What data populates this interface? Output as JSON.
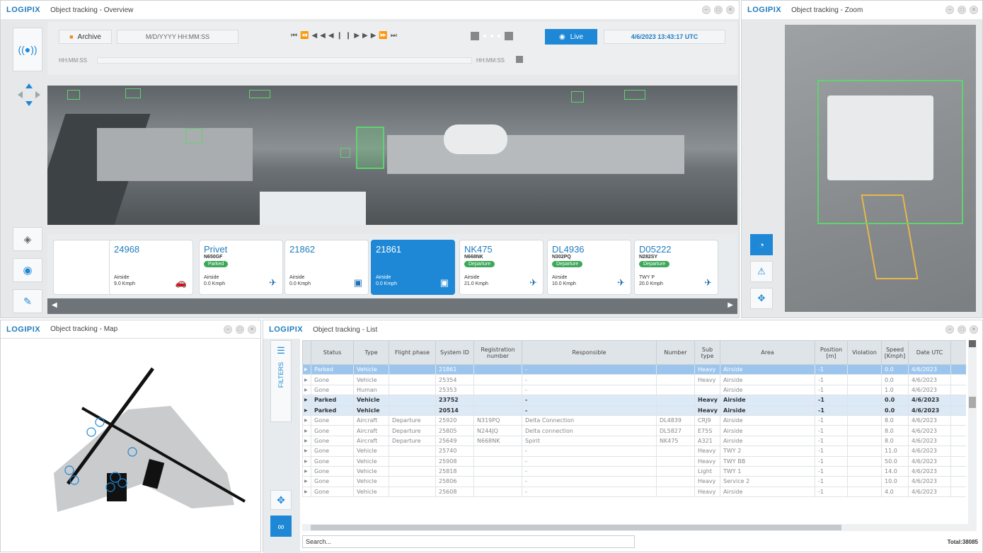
{
  "overview": {
    "logo": "LOGIPIX",
    "title": "Object tracking - Overview",
    "archive_label": "Archive",
    "datetime_placeholder": "M/D/YYYY HH:MM:SS",
    "live_label": "Live",
    "current_time": "4/6/2023 13:43:17 UTC",
    "time_start": "HH:MM:SS",
    "time_end": "HH:MM:SS",
    "cards": [
      {
        "id": "",
        "reg": "",
        "badge": "",
        "area": "",
        "speed": "",
        "icon": "bus"
      },
      {
        "id": "24968",
        "reg": "",
        "badge": "",
        "area": "Airside",
        "speed": "9.0 Kmph",
        "icon": "car"
      },
      {
        "id": "Privet",
        "reg": "N650GF",
        "badge": "Parked",
        "area": "Airside",
        "speed": "0.0 Kmph",
        "icon": "plane"
      },
      {
        "id": "21862",
        "reg": "",
        "badge": "",
        "area": "Airside",
        "speed": "0.0 Kmph",
        "icon": "bus"
      },
      {
        "id": "21861",
        "reg": "",
        "badge": "",
        "area": "Airside",
        "speed": "0.0 Kmph",
        "icon": "bus"
      },
      {
        "id": "NK475",
        "reg": "N668NK",
        "badge": "Departure",
        "area": "Airside",
        "speed": "21.0 Kmph",
        "icon": "plane"
      },
      {
        "id": "DL4936",
        "reg": "N302PQ",
        "badge": "Departure",
        "area": "Airside",
        "speed": "10.0 Kmph",
        "icon": "plane"
      },
      {
        "id": "D05222",
        "reg": "N282SY",
        "badge": "Departure",
        "area": "TWY P",
        "speed": "20.0 Kmph",
        "icon": "plane"
      }
    ]
  },
  "zoom": {
    "logo": "LOGIPIX",
    "title": "Object tracking - Zoom"
  },
  "map": {
    "logo": "LOGIPIX",
    "title": "Object tracking - Map"
  },
  "list": {
    "logo": "LOGIPIX",
    "title": "Object tracking - List",
    "filters_label": "FILTERS",
    "search_placeholder": "Search...",
    "total": "Total:38085",
    "columns": [
      "Status",
      "Type",
      "Flight phase",
      "System ID",
      "Registration number",
      "Responsible",
      "Number",
      "Sub type",
      "Area",
      "Position [m]",
      "Violation",
      "Speed [Kmph]",
      "Date UTC"
    ],
    "rows": [
      [
        "Parked",
        "Vehicle",
        "",
        "21861",
        "",
        "-",
        "",
        "Heavy",
        "Airside",
        "-1",
        "",
        "0.0",
        "4/6/2023"
      ],
      [
        "Gone",
        "Vehicle",
        "",
        "25354",
        "",
        "-",
        "",
        "Heavy",
        "Airside",
        "-1",
        "",
        "0.0",
        "4/6/2023"
      ],
      [
        "Gone",
        "Human",
        "",
        "25353",
        "",
        "-",
        "",
        "",
        "Airside",
        "-1",
        "",
        "1.0",
        "4/6/2023"
      ],
      [
        "Parked",
        "Vehicle",
        "",
        "23752",
        "",
        "-",
        "",
        "Heavy",
        "Airside",
        "-1",
        "",
        "0.0",
        "4/6/2023"
      ],
      [
        "Parked",
        "Vehicle",
        "",
        "20514",
        "",
        "-",
        "",
        "Heavy",
        "Airside",
        "-1",
        "",
        "0.0",
        "4/6/2023"
      ],
      [
        "Gone",
        "Aircraft",
        "Departure",
        "25920",
        "N319PQ",
        "Delta Connection",
        "DL4839",
        "CRJ9",
        "Airside",
        "-1",
        "",
        "8.0",
        "4/6/2023"
      ],
      [
        "Gone",
        "Aircraft",
        "Departure",
        "25805",
        "N244JQ",
        "Delta connection",
        "DL5827",
        "E75S",
        "Airside",
        "-1",
        "",
        "8.0",
        "4/6/2023"
      ],
      [
        "Gone",
        "Aircraft",
        "Departure",
        "25649",
        "N668NK",
        "Spirit",
        "NK475",
        "A321",
        "Airside",
        "-1",
        "",
        "8.0",
        "4/6/2023"
      ],
      [
        "Gone",
        "Vehicle",
        "",
        "25740",
        "",
        "-",
        "",
        "Heavy",
        "TWY 2",
        "-1",
        "",
        "11.0",
        "4/6/2023"
      ],
      [
        "Gone",
        "Vehicle",
        "",
        "25908",
        "",
        "-",
        "",
        "Heavy",
        "TWY BB",
        "-1",
        "",
        "50.0",
        "4/6/2023"
      ],
      [
        "Gone",
        "Vehicle",
        "",
        "25818",
        "",
        "-",
        "",
        "Light",
        "TWY 1",
        "-1",
        "",
        "14.0",
        "4/6/2023"
      ],
      [
        "Gone",
        "Vehicle",
        "",
        "25806",
        "",
        "-",
        "",
        "Heavy",
        "Service 2",
        "-1",
        "",
        "10.0",
        "4/6/2023"
      ],
      [
        "Gone",
        "Vehicle",
        "",
        "25608",
        "",
        "-",
        "",
        "Heavy",
        "Airside",
        "-1",
        "",
        "4.0",
        "4/6/2023"
      ]
    ]
  }
}
